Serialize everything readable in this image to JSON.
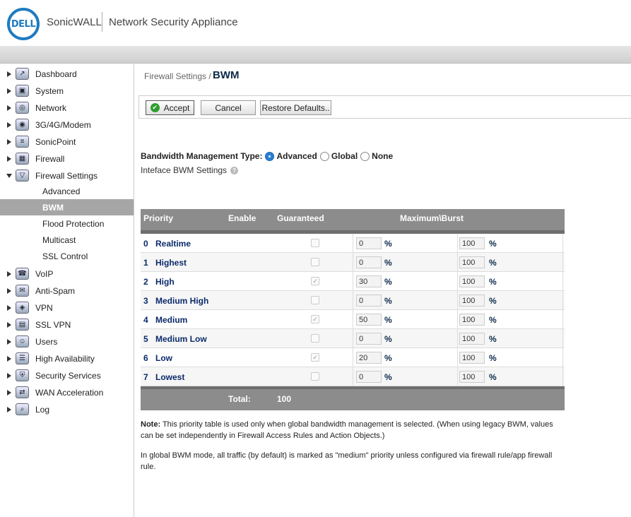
{
  "header": {
    "logo_text": "DELL",
    "brand": "SonicWALL",
    "product": "Network Security Appliance"
  },
  "sidebar": {
    "items": [
      {
        "label": "Dashboard",
        "icon": "dashboard-icon"
      },
      {
        "label": "System",
        "icon": "system-icon"
      },
      {
        "label": "Network",
        "icon": "network-icon"
      },
      {
        "label": "3G/4G/Modem",
        "icon": "modem-icon"
      },
      {
        "label": "SonicPoint",
        "icon": "sonicpoint-icon"
      },
      {
        "label": "Firewall",
        "icon": "firewall-icon"
      },
      {
        "label": "Firewall Settings",
        "icon": "firewall-settings-icon"
      },
      {
        "label": "VoIP",
        "icon": "voip-icon"
      },
      {
        "label": "Anti-Spam",
        "icon": "anti-spam-icon"
      },
      {
        "label": "VPN",
        "icon": "vpn-icon"
      },
      {
        "label": "SSL VPN",
        "icon": "ssl-vpn-icon"
      },
      {
        "label": "Users",
        "icon": "users-icon"
      },
      {
        "label": "High Availability",
        "icon": "high-availability-icon"
      },
      {
        "label": "Security Services",
        "icon": "security-services-icon"
      },
      {
        "label": "WAN Acceleration",
        "icon": "wan-acceleration-icon"
      },
      {
        "label": "Log",
        "icon": "log-icon"
      }
    ],
    "sub_items": [
      {
        "label": "Advanced"
      },
      {
        "label": "BWM"
      },
      {
        "label": "Flood Protection"
      },
      {
        "label": "Multicast"
      },
      {
        "label": "SSL Control"
      }
    ]
  },
  "main": {
    "breadcrumb": "Firewall Settings /",
    "title": "BWM",
    "buttons": {
      "accept": "Accept",
      "cancel": "Cancel",
      "restore": "Restore Defaults.."
    },
    "bwm_type_label": "Bandwidth Management Type:",
    "bwm_options": {
      "advanced": "Advanced",
      "global": "Global",
      "none": "None",
      "selected": "Advanced"
    },
    "iface_settings": "Inteface BWM Settings",
    "table": {
      "headers": {
        "priority": "Priority",
        "enable": "Enable",
        "guaranteed": "Guaranteed",
        "max_burst": "Maximum\\Burst"
      },
      "pct_symbol": "%",
      "rows": [
        {
          "num": "0",
          "name": "Realtime",
          "enabled": false,
          "guaranteed": "0",
          "max": "100"
        },
        {
          "num": "1",
          "name": "Highest",
          "enabled": false,
          "guaranteed": "0",
          "max": "100"
        },
        {
          "num": "2",
          "name": "High",
          "enabled": true,
          "guaranteed": "30",
          "max": "100"
        },
        {
          "num": "3",
          "name": "Medium High",
          "enabled": false,
          "guaranteed": "0",
          "max": "100"
        },
        {
          "num": "4",
          "name": "Medium",
          "enabled": true,
          "guaranteed": "50",
          "max": "100"
        },
        {
          "num": "5",
          "name": "Medium Low",
          "enabled": false,
          "guaranteed": "0",
          "max": "100"
        },
        {
          "num": "6",
          "name": "Low",
          "enabled": true,
          "guaranteed": "20",
          "max": "100"
        },
        {
          "num": "7",
          "name": "Lowest",
          "enabled": false,
          "guaranteed": "0",
          "max": "100"
        }
      ],
      "total_label": "Total:",
      "total_value": "100"
    },
    "note_label": "Note:",
    "note_text": " This priority table is used only when global bandwidth management is selected. (When using legacy BWM, values can be set independently in Firewall Access Rules and Action Objects.)",
    "note2_text": "In global BWM mode, all traffic (by default) is marked as \"medium\" priority unless configured via firewall rule/app firewall rule."
  }
}
